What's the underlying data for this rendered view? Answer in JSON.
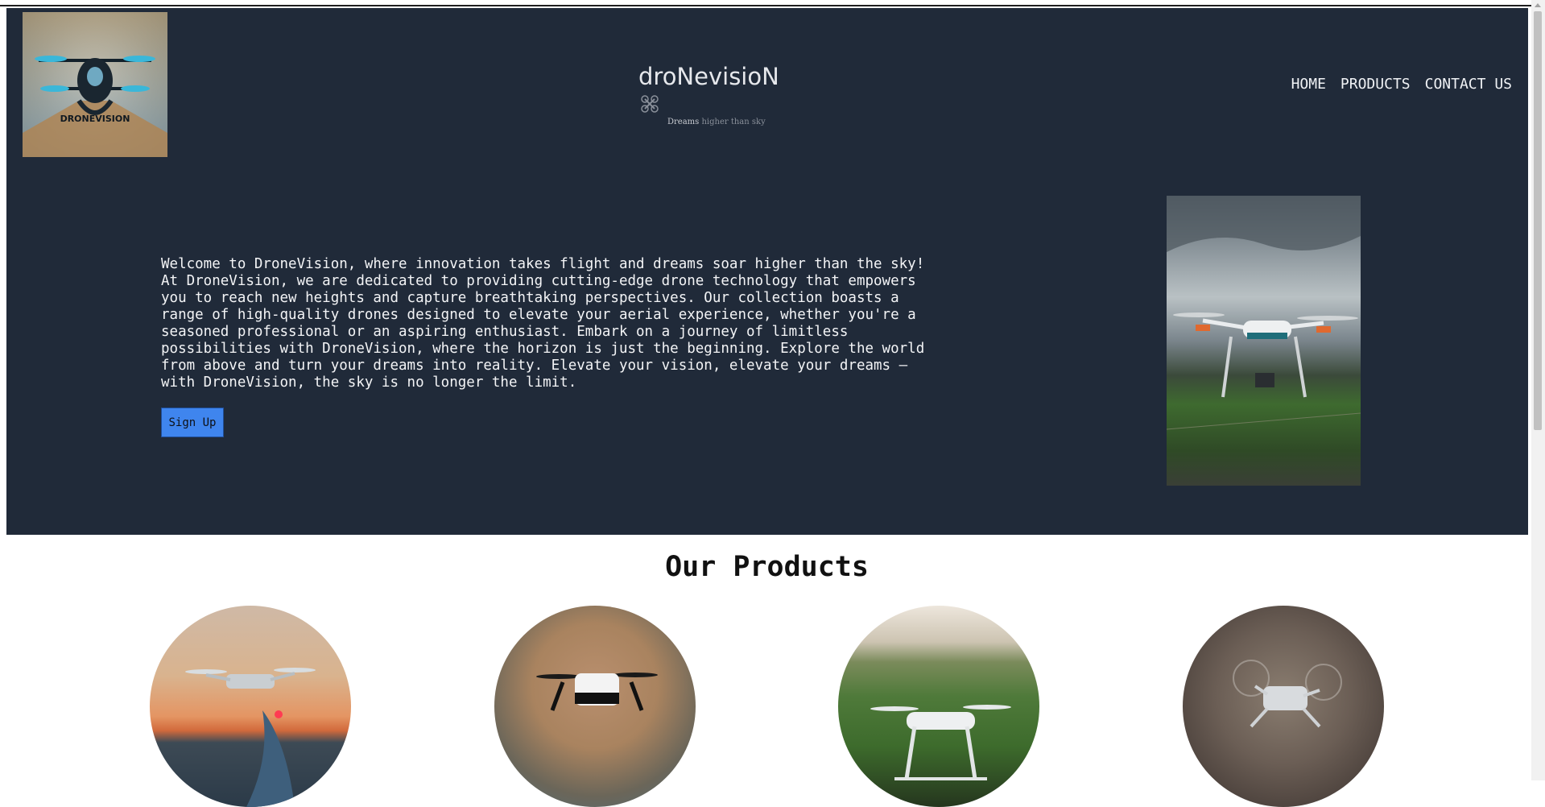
{
  "header": {
    "logo_alt": "DRONEVISION",
    "brand_name": "droNevisioN",
    "tagline_main": "Dreams",
    "tagline_dim": "higher than sky",
    "nav": [
      {
        "label": "HOME"
      },
      {
        "label": "PRODUCTS"
      },
      {
        "label": "CONTACT US"
      }
    ]
  },
  "hero": {
    "intro_text": "Welcome to DroneVision, where innovation takes flight and dreams soar higher than the sky!\nAt DroneVision, we are dedicated to providing cutting-edge drone technology that empowers\nyou to reach new heights and capture breathtaking perspectives. Our collection boasts a\nrange of high-quality drones designed to elevate your aerial experience, whether you're a\nseasoned professional or an aspiring enthusiast. Embark on a journey of limitless\npossibilities with DroneVision, where the horizon is just the beginning. Explore the world\nfrom above and turn your dreams into reality. Elevate your vision, elevate your dreams —\nwith DroneVision, the sky is no longer the limit.",
    "signup_label": "Sign Up"
  },
  "products": {
    "title": "Our Products"
  },
  "colors": {
    "hero_bg": "#202a39",
    "button_bg": "#3f85ee"
  }
}
